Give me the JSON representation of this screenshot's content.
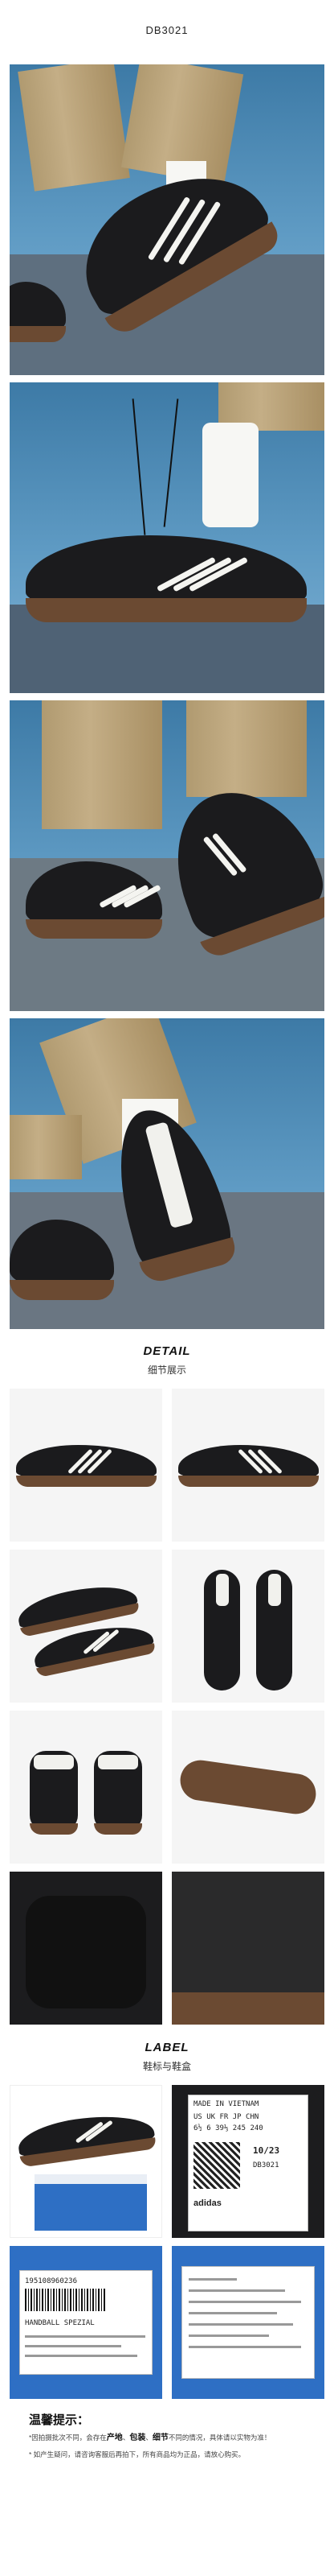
{
  "product": {
    "code": "DB3021"
  },
  "detail": {
    "en": "DETAIL",
    "cn": "细节展示"
  },
  "label_section": {
    "en": "LABEL",
    "cn": "鞋标与鞋盒"
  },
  "label_tag": {
    "line1": "MADE IN VIETNAM",
    "line2": "US  UK  FR  JP  CHN",
    "line3": "6½  6  39⅓ 245 240",
    "date": "10/23",
    "article": "DB3021",
    "brand": "adidas"
  },
  "box_label": {
    "barcode_number": "195108960236",
    "model": "HANDBALL SPEZIAL"
  },
  "tips": {
    "title": "温馨提示：",
    "line1_pre": "*因拍摄批次不同，会存在",
    "line1_b1": "产地",
    "line1_s1": "、",
    "line1_b2": "包装",
    "line1_s2": "、",
    "line1_b3": "细节",
    "line1_post": "不同的情况，具体请以实物为准！",
    "line2": "* 如产生疑问，请咨询客服后再拍下，所有商品均为正品，请放心购买。"
  },
  "colors": {
    "upper": "#1b1b1d",
    "gum_sole": "#6b4a32",
    "stripes": "#f4f4f0",
    "sky": "#5f9bc4",
    "box_blue": "#2e6fc4"
  }
}
